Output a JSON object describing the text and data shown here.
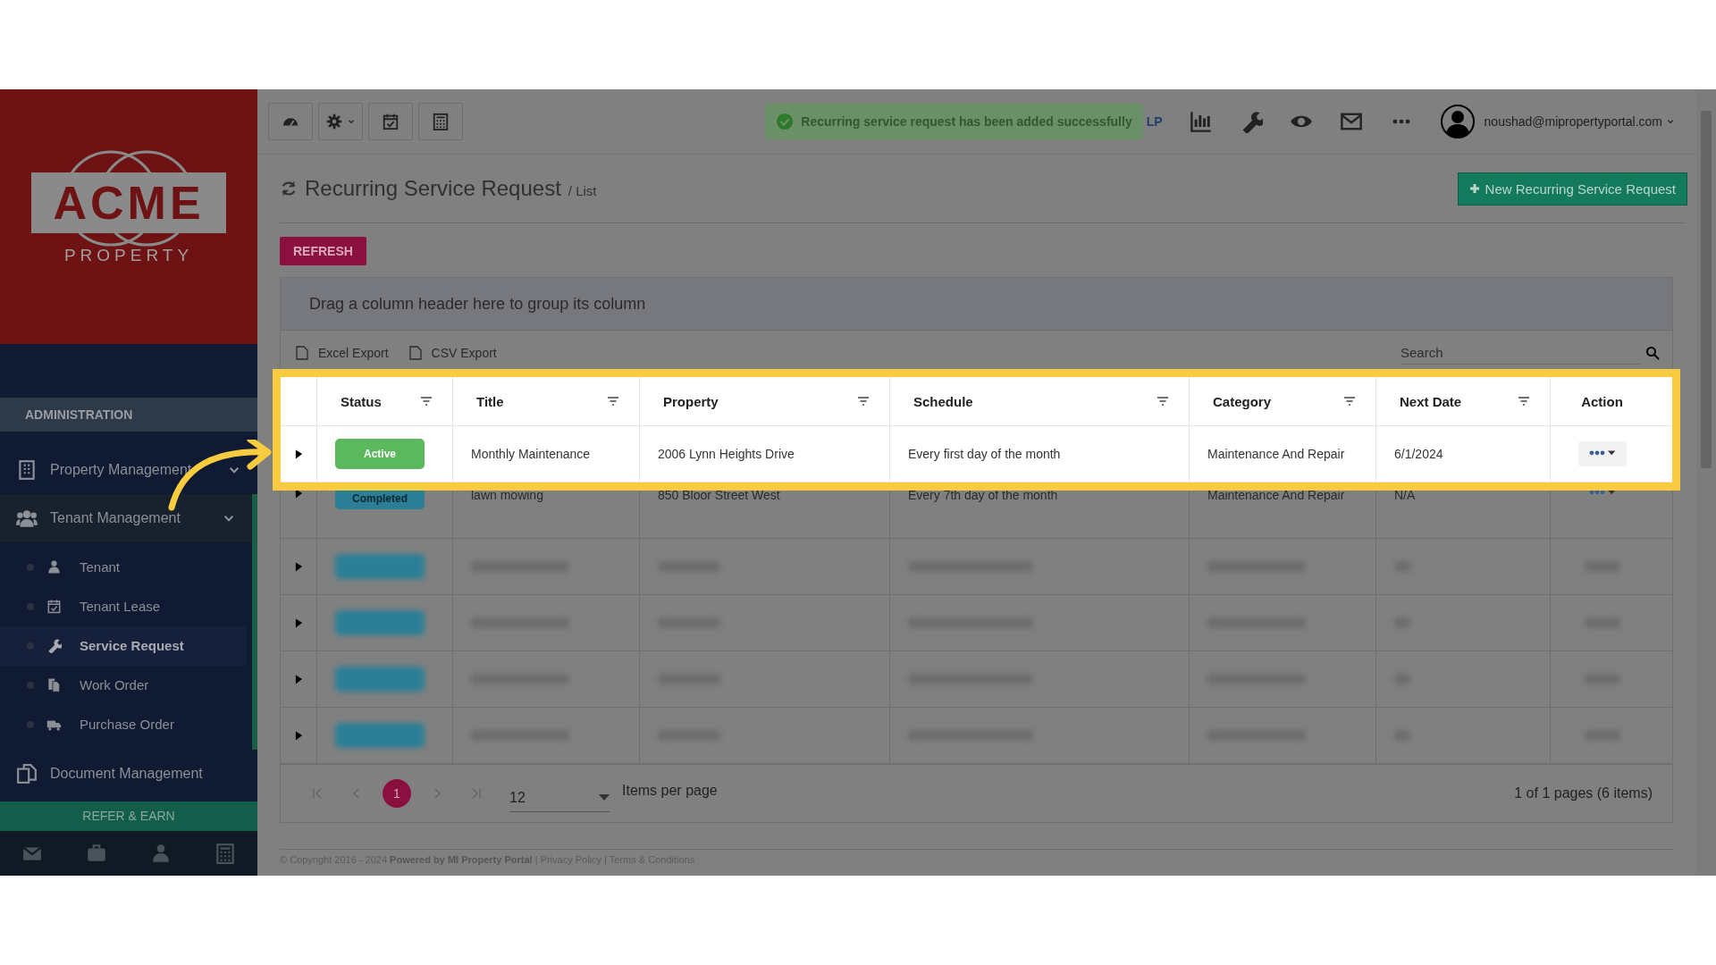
{
  "logo": {
    "name": "ACME",
    "tagline": "PROPERTY"
  },
  "sidebar": {
    "section": "ADMINISTRATION",
    "items": [
      {
        "label": "Property Management",
        "expandable": true,
        "expanded": false
      },
      {
        "label": "Tenant Management",
        "expandable": true,
        "expanded": true,
        "children": [
          {
            "label": "Tenant",
            "selected": false
          },
          {
            "label": "Tenant Lease",
            "selected": false
          },
          {
            "label": "Service Request",
            "selected": true
          },
          {
            "label": "Work Order",
            "selected": false
          },
          {
            "label": "Purchase Order",
            "selected": false
          }
        ]
      },
      {
        "label": "Document Management",
        "expandable": false,
        "expanded": false
      }
    ],
    "refer_button": "REFER & EARN"
  },
  "topbar": {
    "toast": "Recurring service request has been added successfully",
    "label": "LP",
    "user": "noushad@mipropertyportal.com"
  },
  "page": {
    "title": "Recurring Service Request",
    "crumb": "/ List",
    "new_button": "New Recurring Service Request",
    "refresh_button": "REFRESH"
  },
  "grid": {
    "group_hint": "Drag a column header here to group its column",
    "exports": [
      "Excel Export",
      "CSV Export"
    ],
    "search": {
      "placeholder": "Search"
    },
    "columns": [
      {
        "label": "Status",
        "filter": true
      },
      {
        "label": "Title",
        "filter": true
      },
      {
        "label": "Property",
        "filter": true
      },
      {
        "label": "Schedule",
        "filter": true
      },
      {
        "label": "Category",
        "filter": true
      },
      {
        "label": "Next Date",
        "filter": true
      },
      {
        "label": "Action",
        "filter": false
      }
    ],
    "rows": [
      {
        "kind": "highlighted",
        "status": "Active",
        "color": "#5cb85c",
        "cells": [
          "Monthly Maintenance",
          "2006 Lynn Heights Drive",
          "Every first day of the month",
          "Maintenance And Repair",
          "6/1/2024"
        ]
      },
      {
        "kind": "dimmed",
        "status": "Completed",
        "color": "#2a7f96",
        "cells": [
          "lawn mowing",
          "850 Bloor Street West",
          "Every 7th day of the month",
          "Maintenance And Repair",
          "N/A"
        ]
      },
      {
        "kind": "blurred"
      },
      {
        "kind": "blurred"
      },
      {
        "kind": "blurred"
      },
      {
        "kind": "blurred"
      }
    ]
  },
  "pager": {
    "pages": [
      {
        "label": "1",
        "selected": true
      }
    ],
    "page_size": "12",
    "page_size_label": "Items per page",
    "summary": "1 of 1 pages (6 items)"
  },
  "footer": "© Copyright 2016 - 2024 **Powered by MI Property Portal** | Privacy Policy | Terms & Conditions"
}
